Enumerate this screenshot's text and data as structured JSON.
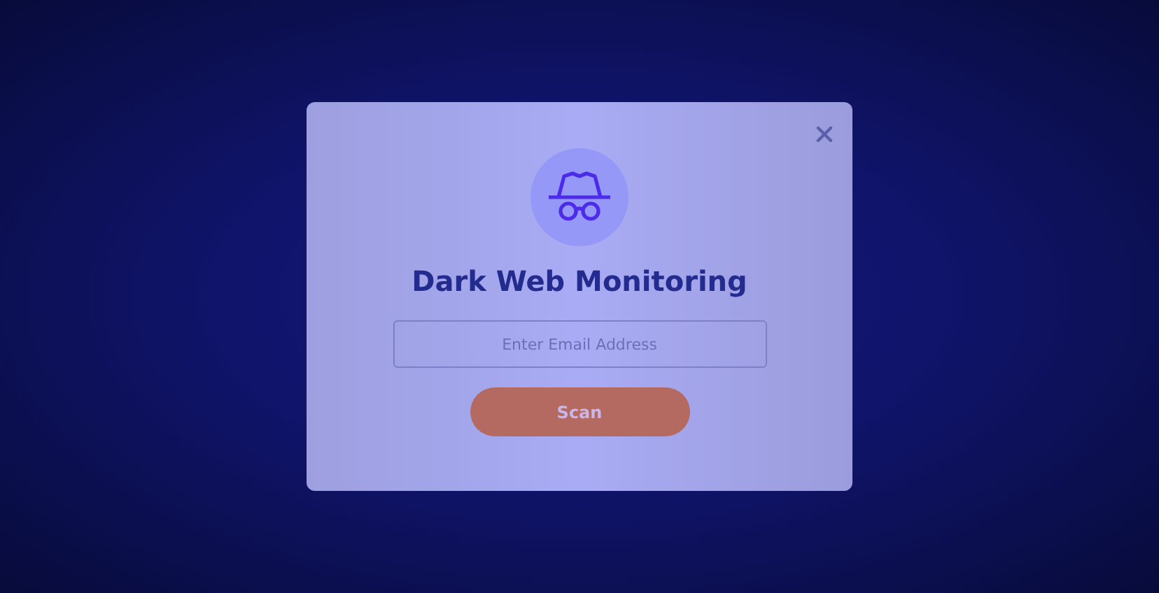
{
  "dialog": {
    "title": "Dark Web Monitoring",
    "email_field": {
      "placeholder": "Enter Email Address"
    },
    "scan_button": {
      "label": "Scan"
    }
  }
}
